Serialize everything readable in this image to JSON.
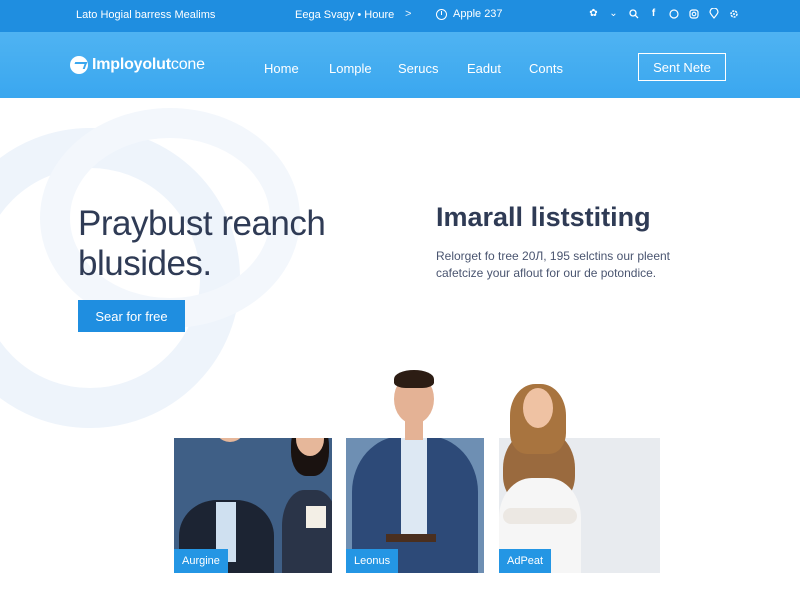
{
  "topbar": {
    "left_text": "Lato Hogial barress Mealims",
    "mid_text": "Eega Svagy • Houre",
    "arrow": ">",
    "date_text": "Apple 237",
    "social_icons": [
      "flower-icon",
      "chevron-down-icon",
      "search-icon",
      "facebook-icon",
      "whatsapp-icon",
      "instagram-icon",
      "location-pin-icon",
      "settings-icon"
    ]
  },
  "nav": {
    "logo_bold": "Imployolut",
    "logo_light": "cone",
    "links": [
      "Home",
      "Lomple",
      "Serucs",
      "Eadut",
      "Conts"
    ],
    "button_label": "Sent Nete"
  },
  "hero": {
    "title": "Praybust reanch blusides.",
    "cta_label": "Sear for free",
    "side_title_bold": "Imarall",
    "side_title_light": " liststiting",
    "side_text": "Relorget fo tree 20Л, 195 selctins our pleent cafetcize your aflout for our de potondice."
  },
  "cards": [
    {
      "label": "Aurgine"
    },
    {
      "label": "Leonus"
    },
    {
      "label": "AdPeat"
    }
  ],
  "colors": {
    "topbar": "#1f8ee0",
    "navbar": "#3aa7ef",
    "accent": "#2496e4",
    "heading": "#2f3b55"
  }
}
